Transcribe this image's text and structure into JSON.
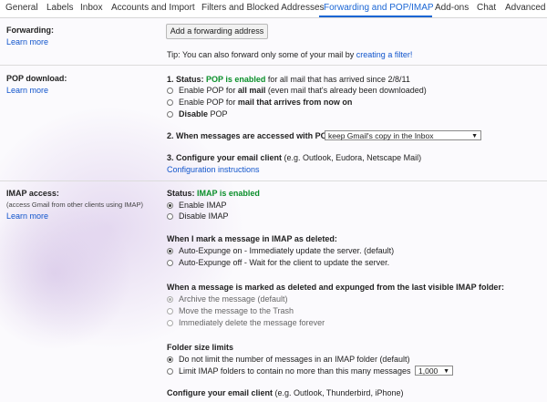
{
  "tabs": [
    "General",
    "Labels",
    "Inbox",
    "Accounts and Import",
    "Filters and Blocked Addresses",
    "Forwarding and POP/IMAP",
    "Add-ons",
    "Chat",
    "Advanced"
  ],
  "forwarding": {
    "label": "Forwarding:",
    "learn_more": "Learn more",
    "add_button": "Add a forwarding address",
    "tip_prefix": "Tip: You can also forward only some of your mail by",
    "tip_link": "creating a filter!"
  },
  "pop": {
    "label": "POP download:",
    "learn_more": "Learn more",
    "status_prefix": "1. Status:",
    "status_value": "POP is enabled",
    "status_suffix": "for all mail that has arrived since 2/8/11",
    "options": [
      {
        "pre": "Enable POP for ",
        "bold": "all mail",
        "post": " (even mail that's already been downloaded)",
        "selected": false
      },
      {
        "pre": "Enable POP for ",
        "bold": "mail that arrives from now on",
        "post": "",
        "selected": false
      },
      {
        "pre": "",
        "bold": "Disable",
        "post": " POP",
        "selected": false
      }
    ],
    "when_accessed": "2. When messages are accessed with POP",
    "when_accessed_select": "keep Gmail's copy in the Inbox",
    "configure_bold": "3. Configure your email client",
    "configure_rest": "(e.g. Outlook, Eudora, Netscape Mail)",
    "config_link": "Configuration instructions"
  },
  "imap": {
    "label": "IMAP access:",
    "sublabel": "(access Gmail from other clients using IMAP)",
    "learn_more": "Learn more",
    "status_prefix": "Status:",
    "status_value": "IMAP is enabled",
    "enable_options": [
      {
        "label": "Enable IMAP",
        "selected": true
      },
      {
        "label": "Disable IMAP",
        "selected": false
      }
    ],
    "deleted_heading": "When I mark a message in IMAP as deleted:",
    "deleted_options": [
      {
        "label": "Auto-Expunge on - Immediately update the server. (default)",
        "selected": true
      },
      {
        "label": "Auto-Expunge off - Wait for the client to update the server.",
        "selected": false
      }
    ],
    "expunged_heading": "When a message is marked as deleted and expunged from the last visible IMAP folder:",
    "expunged_options": [
      {
        "label": "Archive the message (default)",
        "selected": true
      },
      {
        "label": "Move the message to the Trash",
        "selected": false
      },
      {
        "label": "Immediately delete the message forever",
        "selected": false
      }
    ],
    "folder_heading": "Folder size limits",
    "folder_options": [
      {
        "label": "Do not limit the number of messages in an IMAP folder (default)",
        "selected": true
      },
      {
        "label": "Limit IMAP folders to contain no more than this many messages",
        "selected": false
      }
    ],
    "folder_limit_select": "1,000",
    "configure_bold": "Configure your email client",
    "configure_rest": "(e.g. Outlook, Thunderbird, iPhone)"
  }
}
